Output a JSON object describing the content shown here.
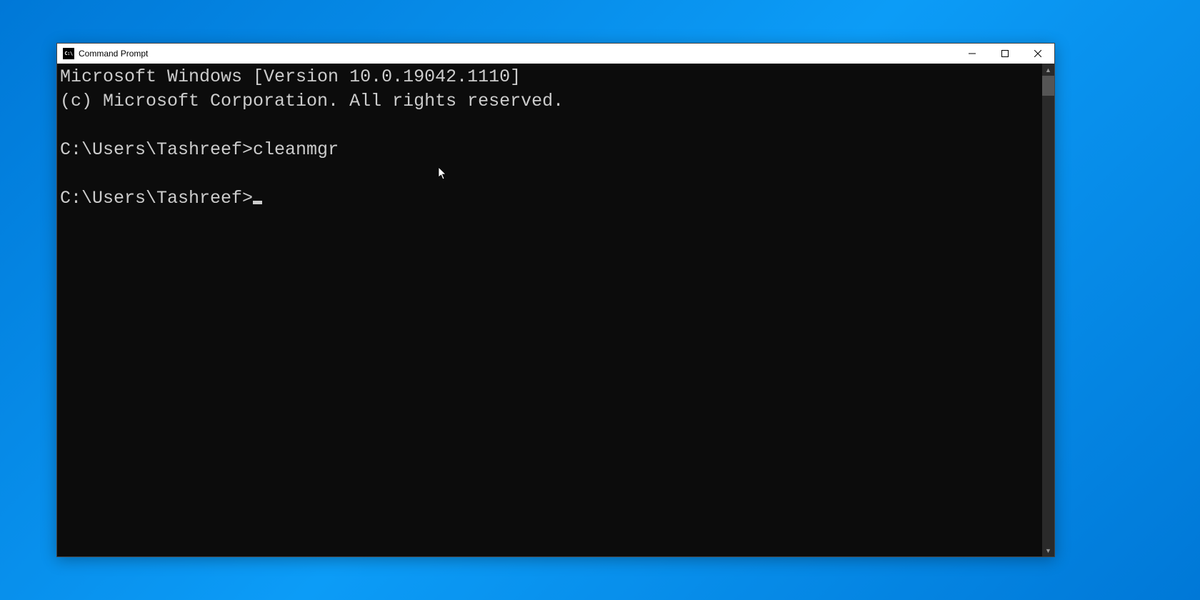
{
  "window": {
    "title": "Command Prompt",
    "icon_label": "C:\\"
  },
  "console": {
    "line1": "Microsoft Windows [Version 10.0.19042.1110]",
    "line2": "(c) Microsoft Corporation. All rights reserved.",
    "blank1": "",
    "prompt1": "C:\\Users\\Tashreef>",
    "command1": "cleanmgr",
    "blank2": "",
    "prompt2": "C:\\Users\\Tashreef>"
  }
}
